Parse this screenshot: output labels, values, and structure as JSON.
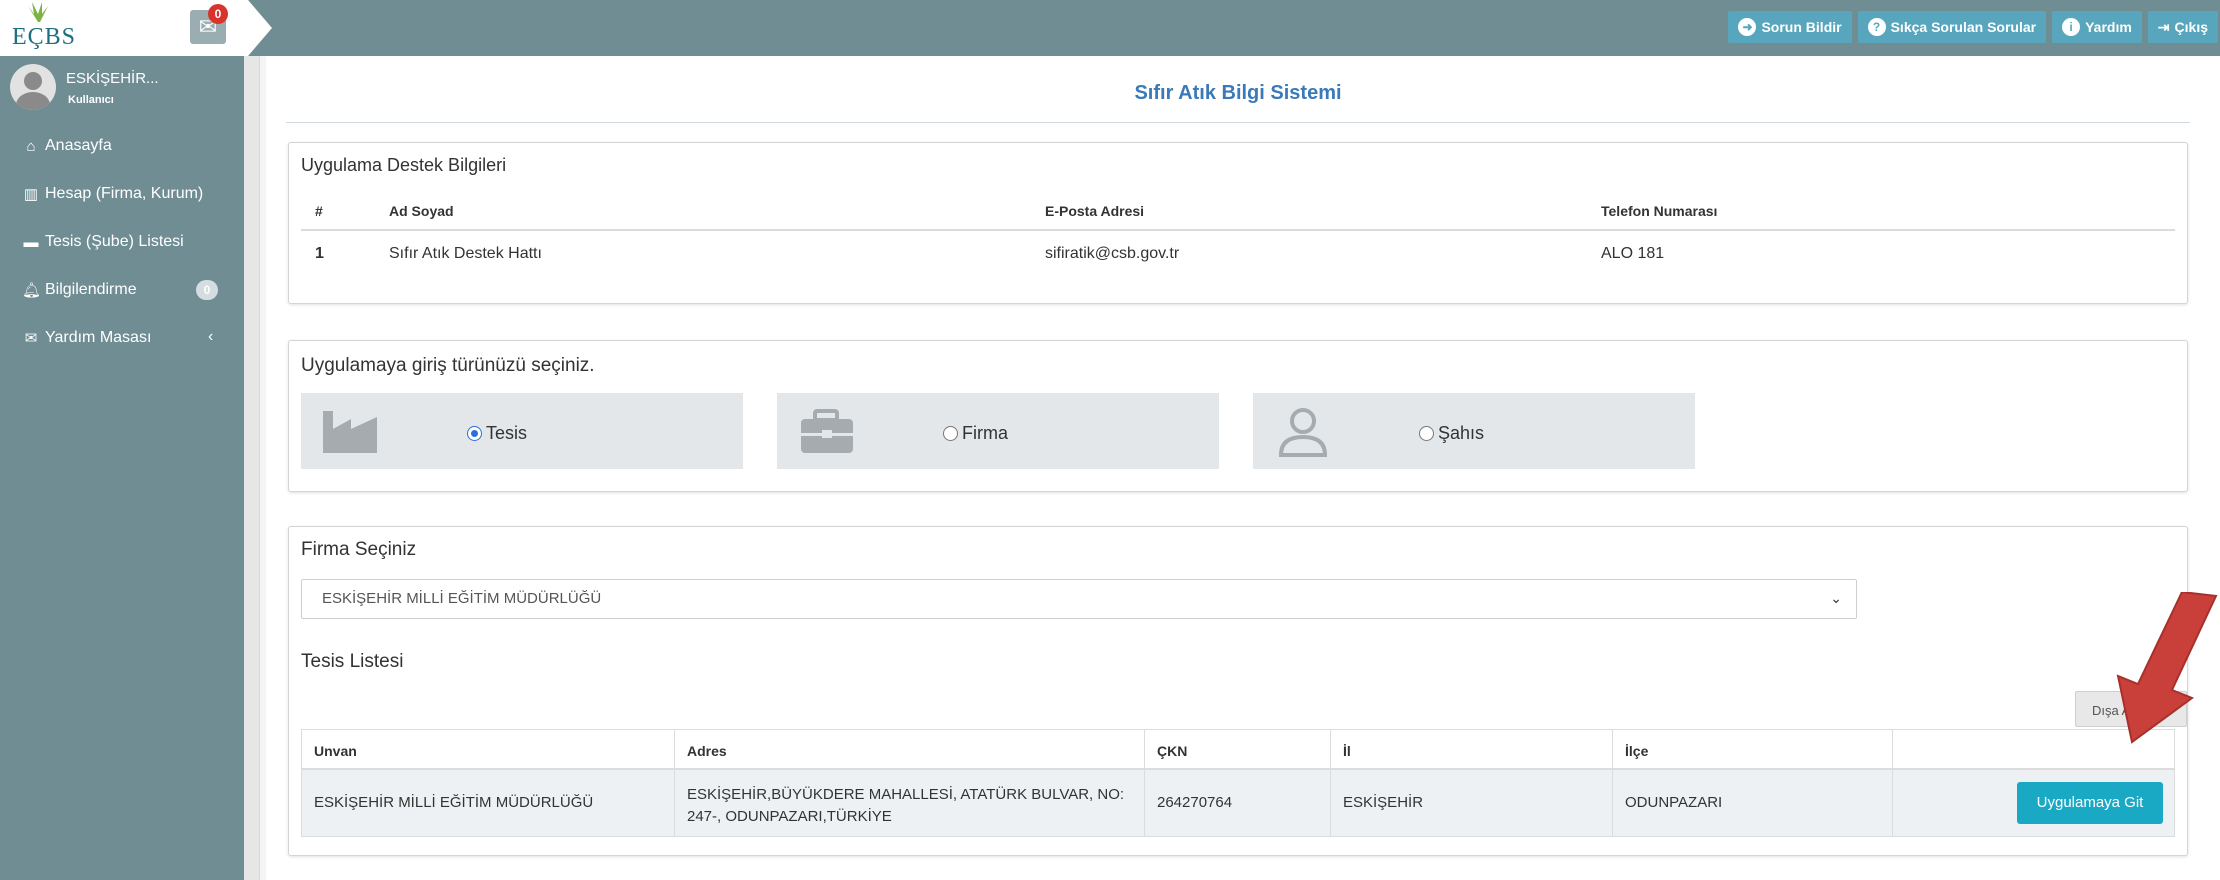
{
  "header": {
    "logo_text": "EÇBS",
    "mail_badge": "0",
    "buttons": [
      {
        "label": "Sorun Bildir",
        "icon": "arrow-circle-icon"
      },
      {
        "label": "Sıkça Sorulan Sorular",
        "icon": "question-icon"
      },
      {
        "label": "Yardım",
        "icon": "info-icon"
      },
      {
        "label": "Çıkış",
        "icon": "sign-out-icon"
      }
    ]
  },
  "sidebar": {
    "user_name": "ESKİŞEHİR...",
    "user_role": "Kullanıcı",
    "items": [
      {
        "label": "Anasayfa",
        "icon": "home-icon"
      },
      {
        "label": "Hesap (Firma, Kurum)",
        "icon": "building-icon"
      },
      {
        "label": "Tesis (Şube) Listesi",
        "icon": "store-icon"
      },
      {
        "label": "Bilgilendirme",
        "icon": "bell-icon",
        "badge": "0"
      },
      {
        "label": "Yardım Masası",
        "icon": "envelope-icon"
      }
    ]
  },
  "main": {
    "title": "Sıfır Atık Bilgi Sistemi",
    "support": {
      "title": "Uygulama Destek Bilgileri",
      "columns": [
        "#",
        "Ad Soyad",
        "E-Posta Adresi",
        "Telefon Numarası"
      ],
      "rows": [
        [
          "1",
          "Sıfır Atık Destek Hattı",
          "sifiratik@csb.gov.tr",
          "ALO 181"
        ]
      ]
    },
    "login_type": {
      "title": "Uygulamaya giriş türünüzü seçiniz.",
      "options": [
        {
          "label": "Tesis",
          "selected": true,
          "icon": "factory-icon"
        },
        {
          "label": "Firma",
          "selected": false,
          "icon": "briefcase-icon"
        },
        {
          "label": "Şahıs",
          "selected": false,
          "icon": "user-icon"
        }
      ]
    },
    "firm": {
      "title": "Firma Seçiniz",
      "selected": "ESKİŞEHİR MİLLİ EĞİTİM MÜDÜRLÜĞÜ",
      "list_title": "Tesis Listesi",
      "export_label": "Dışa Aktar",
      "columns": [
        "Unvan",
        "Adres",
        "ÇKN",
        "İl",
        "İlçe",
        ""
      ],
      "rows": [
        {
          "unvan": "ESKİŞEHİR MİLLİ EĞİTİM MÜDÜRLÜĞÜ",
          "adres": "ESKİŞEHİR,BÜYÜKDERE MAHALLESİ, ATATÜRK BULVAR, NO: 247-, ODUNPAZARI,TÜRKİYE",
          "ckn": "264270764",
          "il": "ESKİŞEHİR",
          "ilce": "ODUNPAZARI",
          "action": "Uygulamaya Git"
        }
      ]
    }
  },
  "colors": {
    "topbar": "#6f8d93",
    "accent_button": "#19a9c4",
    "title": "#3a7ab8",
    "annotation_arrow": "#c9403a"
  }
}
